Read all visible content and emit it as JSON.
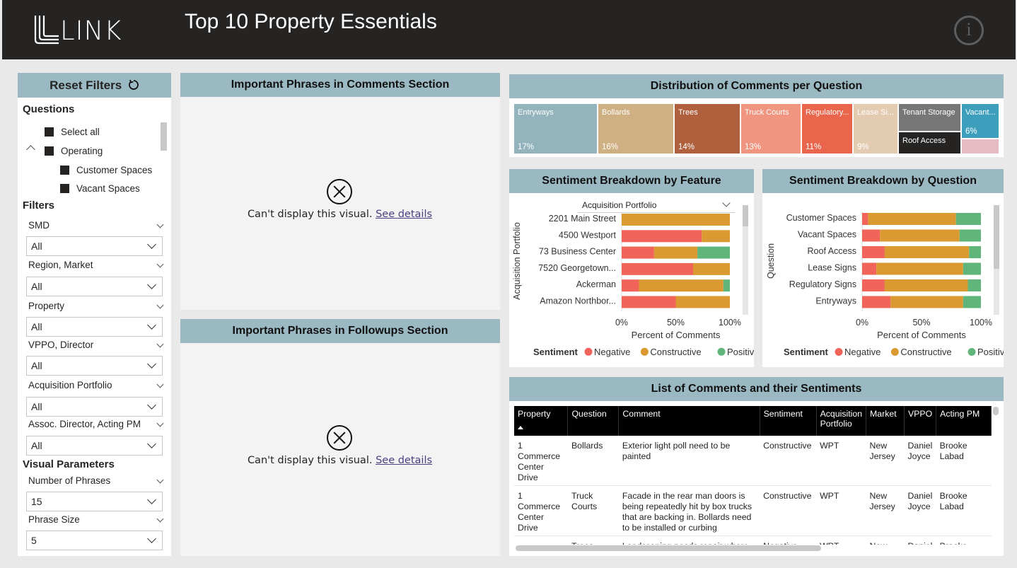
{
  "header": {
    "logo_text": "LINK",
    "title": "Top 10 Property Essentials",
    "info_label": "i"
  },
  "filters": {
    "reset_label": "Reset Filters",
    "reset_icon": "refresh-icon",
    "questions_title": "Questions",
    "question_items": [
      "Select all",
      "Operating",
      "Customer Spaces",
      "Vacant Spaces"
    ],
    "filters_title": "Filters",
    "dropdowns": [
      {
        "label": "SMD",
        "value": "All"
      },
      {
        "label": "Region, Market",
        "value": "All"
      },
      {
        "label": "Property",
        "value": "All"
      },
      {
        "label": "VPPO, Director",
        "value": "All"
      },
      {
        "label": "Acquisition Portfolio",
        "value": "All"
      },
      {
        "label": "Assoc. Director, Acting PM",
        "value": "All"
      }
    ],
    "visual_params_title": "Visual Parameters",
    "params": [
      {
        "label": "Number of Phrases",
        "value": "15"
      },
      {
        "label": "Phrase Size",
        "value": "5"
      }
    ]
  },
  "phrases_comments": {
    "title": "Important Phrases in Comments Section",
    "error_text": "Can't display this visual.",
    "link_text": "See details"
  },
  "phrases_followups": {
    "title": "Important Phrases in Followups Section",
    "error_text": "Can't display this visual.",
    "link_text": "See details"
  },
  "treemap": {
    "title": "Distribution of Comments per Question",
    "tiles": [
      {
        "name": "Entryways",
        "pct": "17%",
        "color": "#93b3bd"
      },
      {
        "name": "Bollards",
        "pct": "16%",
        "color": "#cfb083"
      },
      {
        "name": "Trees",
        "pct": "14%",
        "color": "#b0603d"
      },
      {
        "name": "Truck Courts",
        "pct": "13%",
        "color": "#ef9580"
      },
      {
        "name": "Regulatory...",
        "pct": "11%",
        "color": "#e9654b"
      },
      {
        "name": "Lease Si...",
        "pct": "9%",
        "color": "#e3cbb1"
      },
      {
        "name": "Tenant Storage",
        "pct": "",
        "color": "#777777"
      },
      {
        "name": "Roof Access",
        "pct": "",
        "color": "#252423"
      },
      {
        "name": "Vacant...",
        "pct": "6%",
        "color": "#3e9fbd"
      },
      {
        "name": "",
        "pct": "",
        "color": "#e5bcc3"
      }
    ]
  },
  "feature_chart": {
    "title": "Sentiment Breakdown by Feature",
    "dropdown_value": "Acquisition Portfolio",
    "ylabel": "Acquisition Portfolio",
    "xlabel": "Percent of Comments",
    "ticks": [
      "0%",
      "50%",
      "100%"
    ],
    "legend_title": "Sentiment",
    "legend": [
      "Negative",
      "Constructive",
      "Positive"
    ]
  },
  "question_chart": {
    "title": "Sentiment Breakdown by Question",
    "ylabel": "Question",
    "xlabel": "Percent of Comments",
    "ticks": [
      "0%",
      "50%",
      "100%"
    ],
    "legend_title": "Sentiment",
    "legend": [
      "Negative",
      "Constructive",
      "Positive"
    ]
  },
  "colors": {
    "negative": "#f0645a",
    "constructive": "#da9a31",
    "positive": "#60b67a"
  },
  "chart_data": [
    {
      "type": "bar",
      "orientation": "horizontal-stacked-100",
      "title": "Sentiment Breakdown by Feature",
      "ylabel": "Acquisition Portfolio",
      "xlabel": "Percent of Comments",
      "xlim": [
        0,
        100
      ],
      "categories": [
        "2201 Main Street",
        "4500 Westport",
        "73 Business Center",
        "7520 Georgetown...",
        "Ackerman",
        "Amazon Northbor..."
      ],
      "series": [
        {
          "name": "Negative",
          "values": [
            0,
            74,
            30,
            66,
            16,
            50
          ]
        },
        {
          "name": "Constructive",
          "values": [
            100,
            26,
            40,
            34,
            78,
            50
          ]
        },
        {
          "name": "Positive",
          "values": [
            0,
            0,
            30,
            0,
            6,
            0
          ]
        }
      ]
    },
    {
      "type": "bar",
      "orientation": "horizontal-stacked-100",
      "title": "Sentiment Breakdown by Question",
      "ylabel": "Question",
      "xlabel": "Percent of Comments",
      "xlim": [
        0,
        100
      ],
      "categories": [
        "Customer Spaces",
        "Vacant Spaces",
        "Roof Access",
        "Lease Signs",
        "Regulatory Signs",
        "Entryways"
      ],
      "series": [
        {
          "name": "Negative",
          "values": [
            5,
            15,
            19,
            12,
            19,
            24
          ]
        },
        {
          "name": "Constructive",
          "values": [
            74,
            67,
            71,
            73,
            70,
            61
          ]
        },
        {
          "name": "Positive",
          "values": [
            21,
            18,
            10,
            15,
            11,
            15
          ]
        }
      ]
    }
  ],
  "comments_table": {
    "title": "List of Comments and their Sentiments",
    "columns": [
      "Property",
      "Question",
      "Comment",
      "Sentiment",
      "Acquisition Portfolio",
      "Market",
      "VPPO",
      "Acting PM"
    ],
    "rows": [
      [
        "1 Commerce Center Drive",
        "Bollards",
        "Exterior light poll need to be painted",
        "Constructive",
        "WPT",
        "New Jersey",
        "Daniel Joyce",
        "Brooke Labad"
      ],
      [
        "1 Commerce Center Drive",
        "Truck Courts",
        "Facade in the rear man doors is being repeatedly hit by box trucks that are backing in. Bollards need to be installed or curbing",
        "Constructive",
        "WPT",
        "New Jersey",
        "Daniel Joyce",
        "Brooke Labad"
      ],
      [
        "",
        "Trees",
        "Landscaping needs repair where",
        "Negative",
        "WPT",
        "New",
        "Daniel",
        "Brooke Labad"
      ]
    ]
  }
}
